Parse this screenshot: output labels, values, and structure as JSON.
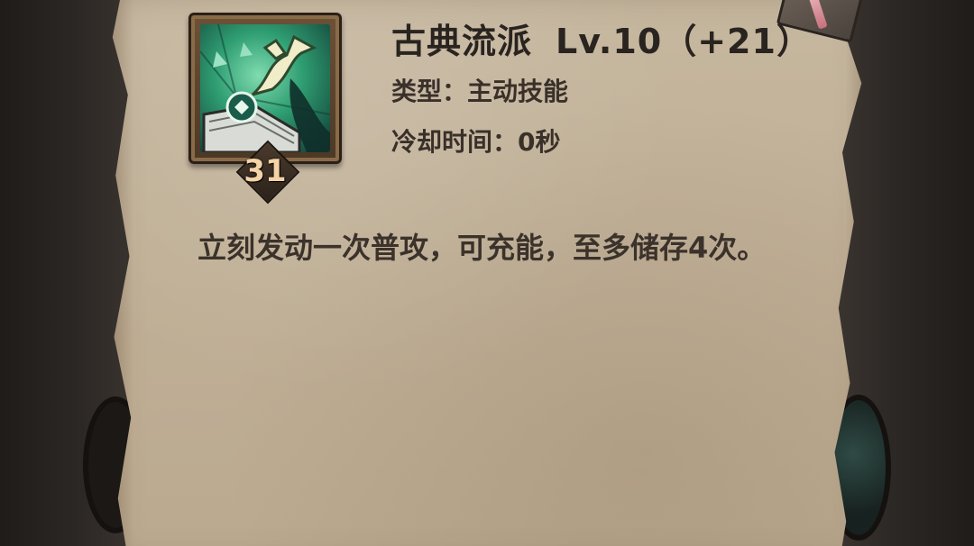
{
  "skill": {
    "name": "古典流派",
    "level_text": "Lv.10（+21）",
    "type_label": "类型：",
    "type_value": "主动技能",
    "cooldown_label": "冷却时间：",
    "cooldown_value": "0秒",
    "description": "立刻发动一次普攻，可充能，至多储存4次。",
    "icon": "green-sword-arrow-book-icon",
    "badge_count": "31"
  },
  "colors": {
    "parchment": "#c1b198",
    "text_dark": "#2a2420",
    "badge_text": "#f4d3a6",
    "icon_green": "#3fae7f"
  }
}
